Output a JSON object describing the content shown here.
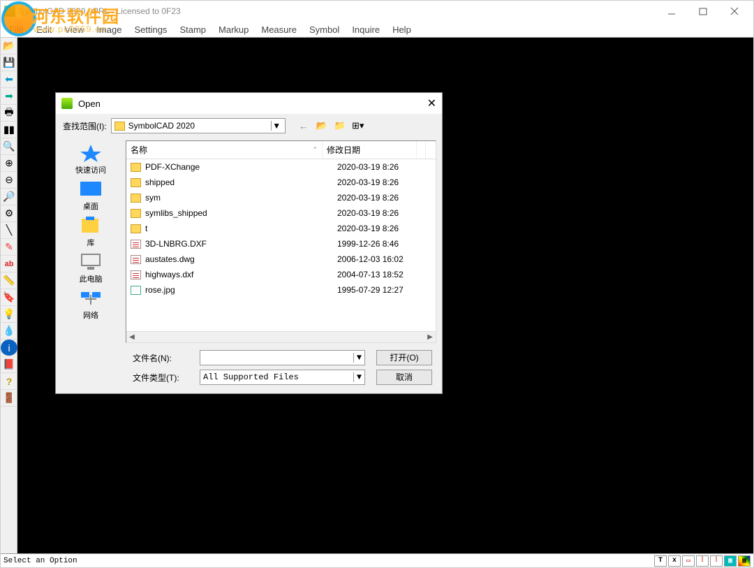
{
  "window": {
    "title": "SymbolCAD 2020 - PRL - Licensed to 0F23"
  },
  "menu": [
    "File",
    "Edit",
    "View",
    "Image",
    "Settings",
    "Stamp",
    "Markup",
    "Measure",
    "Symbol",
    "Inquire",
    "Help"
  ],
  "statusbar": {
    "text": "Select an Option",
    "icons": [
      "T",
      "x",
      "▭",
      "⁞",
      "⁞",
      "▦",
      "▦"
    ]
  },
  "dialog": {
    "title": "Open",
    "lookin_label": "查找范围(I):",
    "lookin_folder": "SymbolCAD 2020",
    "places": [
      {
        "label": "快速访问",
        "icon": "star",
        "color": "#1e88ff"
      },
      {
        "label": "桌面",
        "icon": "desktop",
        "color": "#1e88ff"
      },
      {
        "label": "库",
        "icon": "lib",
        "color": "#1e88ff"
      },
      {
        "label": "此电脑",
        "icon": "pc",
        "color": "#888"
      },
      {
        "label": "网络",
        "icon": "net",
        "color": "#1e88ff"
      }
    ],
    "columns": {
      "name": "名称",
      "date": "修改日期"
    },
    "rows": [
      {
        "name": "PDF-XChange",
        "date": "2020-03-19 8:26",
        "type": "folder"
      },
      {
        "name": "shipped",
        "date": "2020-03-19 8:26",
        "type": "folder"
      },
      {
        "name": "sym",
        "date": "2020-03-19 8:26",
        "type": "folder"
      },
      {
        "name": "symlibs_shipped",
        "date": "2020-03-19 8:26",
        "type": "folder"
      },
      {
        "name": "t",
        "date": "2020-03-19 8:26",
        "type": "folder"
      },
      {
        "name": "3D-LNBRG.DXF",
        "date": "1999-12-26 8:46",
        "type": "doc"
      },
      {
        "name": "austates.dwg",
        "date": "2006-12-03 16:02",
        "type": "doc"
      },
      {
        "name": "highways.dxf",
        "date": "2004-07-13 18:52",
        "type": "doc"
      },
      {
        "name": "rose.jpg",
        "date": "1995-07-29 12:27",
        "type": "jpg"
      }
    ],
    "filename_label": "文件名(N):",
    "filename_value": "",
    "filetype_label": "文件类型(T):",
    "filetype_value": "All Supported Files",
    "open_btn": "打开(O)",
    "cancel_btn": "取消"
  },
  "watermark": {
    "brand": "河东软件园",
    "url": "www.pc0359.cn"
  }
}
